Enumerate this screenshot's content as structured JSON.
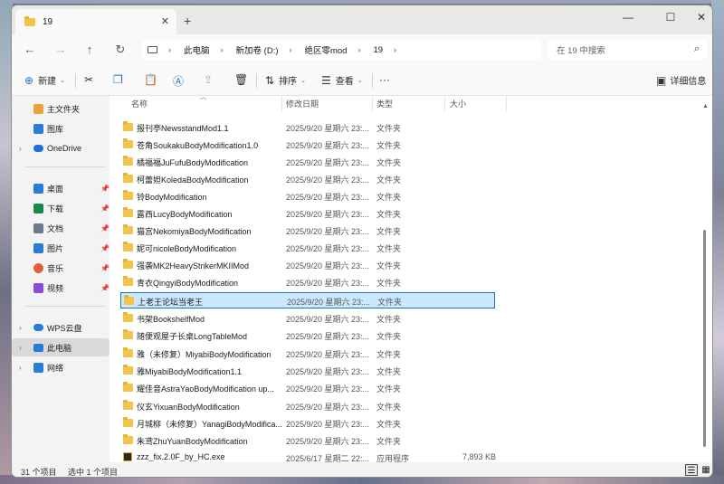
{
  "window": {
    "tab_title": "19",
    "new_tab": "+",
    "min": "—",
    "max": "☐",
    "close": "✕",
    "tab_close": "✕"
  },
  "nav": {
    "back": "←",
    "forward": "→",
    "up": "↑",
    "refresh": "↻",
    "breadcrumbs": [
      "此电脑",
      "新加卷 (D:)",
      "绝区零mod",
      "19"
    ],
    "search_placeholder": "在 19 中搜索"
  },
  "toolbar": {
    "new_label": "新建",
    "sort_label": "排序",
    "view_label": "查看",
    "more": "···",
    "details_label": "详细信息"
  },
  "sidebar": {
    "items": [
      {
        "label": "主文件夹",
        "icon": "home-icon",
        "color": "#e8a33c"
      },
      {
        "label": "图库",
        "icon": "gallery-icon",
        "color": "#2a7bd4"
      },
      {
        "label": "OneDrive",
        "icon": "cloud-icon",
        "color": "#1f6fd6"
      },
      {
        "label": "桌面",
        "icon": "desktop-icon",
        "color": "#2a7bd4"
      },
      {
        "label": "下载",
        "icon": "download-icon",
        "color": "#1a8a4a"
      },
      {
        "label": "文档",
        "icon": "document-icon",
        "color": "#6b7b8c"
      },
      {
        "label": "图片",
        "icon": "picture-icon",
        "color": "#2a7bd4"
      },
      {
        "label": "音乐",
        "icon": "music-icon",
        "color": "#e0603a"
      },
      {
        "label": "视频",
        "icon": "video-icon",
        "color": "#8b4ad4"
      },
      {
        "label": "WPS云盘",
        "icon": "wps-cloud-icon",
        "color": "#2a7bd4"
      },
      {
        "label": "此电脑",
        "icon": "computer-icon",
        "color": "#2a7bd4"
      },
      {
        "label": "网络",
        "icon": "network-icon",
        "color": "#2a7bd4"
      }
    ]
  },
  "columns": {
    "name": "名称",
    "date": "修改日期",
    "type": "类型",
    "size": "大小"
  },
  "files": [
    {
      "name": "报刊亭NewsstandMod1.1",
      "date": "2025/9/20 星期六 23:...",
      "type": "文件夹",
      "size": ""
    },
    {
      "name": "苍角SoukakuBodyModification1.0",
      "date": "2025/9/20 星期六 23:...",
      "type": "文件夹",
      "size": ""
    },
    {
      "name": "橘福福JuFufuBodyModification",
      "date": "2025/9/20 星期六 23:...",
      "type": "文件夹",
      "size": ""
    },
    {
      "name": "柯蕾妲KoledaBodyModification",
      "date": "2025/9/20 星期六 23:...",
      "type": "文件夹",
      "size": ""
    },
    {
      "name": "铃BodyModification",
      "date": "2025/9/20 星期六 23:...",
      "type": "文件夹",
      "size": ""
    },
    {
      "name": "露西LucyBodyModification",
      "date": "2025/9/20 星期六 23:...",
      "type": "文件夹",
      "size": ""
    },
    {
      "name": "猫宫NekomiyaBodyModification",
      "date": "2025/9/20 星期六 23:...",
      "type": "文件夹",
      "size": ""
    },
    {
      "name": "妮可nicoleBodyModification",
      "date": "2025/9/20 星期六 23:...",
      "type": "文件夹",
      "size": ""
    },
    {
      "name": "强袭MK2HeavyStrikerMKIIMod",
      "date": "2025/9/20 星期六 23:...",
      "type": "文件夹",
      "size": ""
    },
    {
      "name": "青衣QingyiBodyModification",
      "date": "2025/9/20 星期六 23:...",
      "type": "文件夹",
      "size": ""
    },
    {
      "name": "上老王论坛当老王",
      "date": "2025/9/20 星期六 23:...",
      "type": "文件夹",
      "size": ""
    },
    {
      "name": "书架BookshelfMod",
      "date": "2025/9/20 星期六 23:...",
      "type": "文件夹",
      "size": ""
    },
    {
      "name": "随便观屋子长桌LongTableMod",
      "date": "2025/9/20 星期六 23:...",
      "type": "文件夹",
      "size": ""
    },
    {
      "name": "雅（未修复）MiyabiBodyModification",
      "date": "2025/9/20 星期六 23:...",
      "type": "文件夹",
      "size": ""
    },
    {
      "name": "雅MiyabiBodyModification1.1",
      "date": "2025/9/20 星期六 23:...",
      "type": "文件夹",
      "size": ""
    },
    {
      "name": "耀佳音AstraYaoBodyModification up...",
      "date": "2025/9/20 星期六 23:...",
      "type": "文件夹",
      "size": ""
    },
    {
      "name": "仪玄YixuanBodyModification",
      "date": "2025/9/20 星期六 23:...",
      "type": "文件夹",
      "size": ""
    },
    {
      "name": "月城柳（未修复）YanagiBodyModifica...",
      "date": "2025/9/20 星期六 23:...",
      "type": "文件夹",
      "size": ""
    },
    {
      "name": "朱鸢ZhuYuanBodyModification",
      "date": "2025/9/20 星期六 23:...",
      "type": "文件夹",
      "size": ""
    },
    {
      "name": "zzz_fix.2.0F_by_HC.exe",
      "date": "2025/6/17 星期二 22:...",
      "type": "应用程序",
      "size": "7,893 KB"
    }
  ],
  "status": {
    "count": "31 个项目",
    "selected": "选中 1 个项目"
  },
  "colors": {
    "folder": "#f2c54a",
    "selection_bg": "#cce8ff",
    "selection_border": "#1a73c8"
  }
}
